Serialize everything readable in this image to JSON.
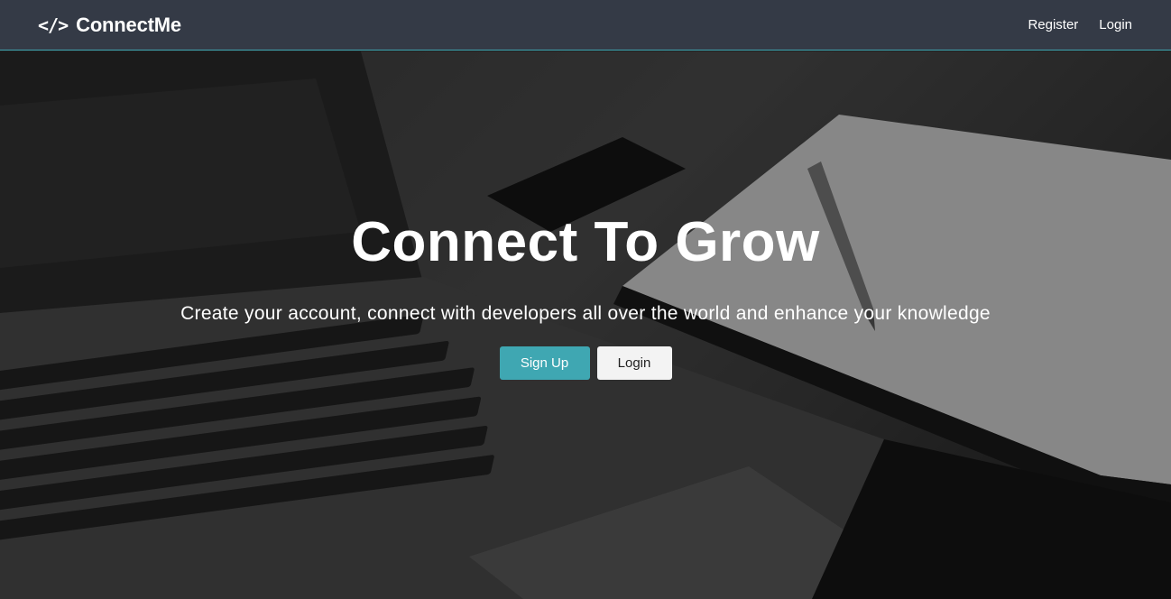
{
  "navbar": {
    "brand_icon": "</>",
    "brand_name": "ConnectMe",
    "links": [
      {
        "label": "Register"
      },
      {
        "label": "Login"
      }
    ]
  },
  "hero": {
    "title": "Connect To Grow",
    "subtitle": "Create your account, connect with developers all over the world and enhance your knowledge",
    "buttons": {
      "signup_label": "Sign Up",
      "login_label": "Login"
    }
  },
  "colors": {
    "navbar_bg": "#343a46",
    "accent": "#3fa7b2",
    "light_button": "#f3f3f3"
  }
}
